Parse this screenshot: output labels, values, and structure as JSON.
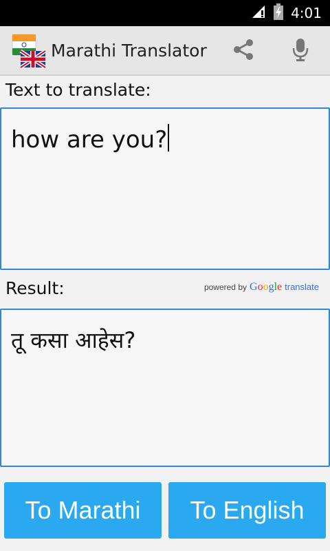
{
  "status_bar": {
    "time": "4:01",
    "icons": [
      "signal-icon",
      "battery-charging-icon"
    ]
  },
  "action_bar": {
    "title": "Marathi Translator",
    "icons": [
      "india-uk-flags-icon",
      "share-icon",
      "microphone-icon"
    ]
  },
  "input": {
    "label": "Text to translate:",
    "value": "how are you?"
  },
  "result": {
    "label": "Result:",
    "value": "तू कसा आहेस?"
  },
  "attribution": {
    "powered_by": "powered by",
    "google_letters": [
      "G",
      "o",
      "o",
      "g",
      "l",
      "e"
    ],
    "google_colors": [
      "#3b6fd9",
      "#d93025",
      "#f2a600",
      "#3b6fd9",
      "#1e9e4a",
      "#d93025"
    ],
    "translate": "translate"
  },
  "buttons": {
    "to_marathi": "To Marathi",
    "to_english": "To English"
  },
  "colors": {
    "accent": "#2aa9f0",
    "border": "#2f88d6",
    "action_bar": "#e6e6e6"
  }
}
